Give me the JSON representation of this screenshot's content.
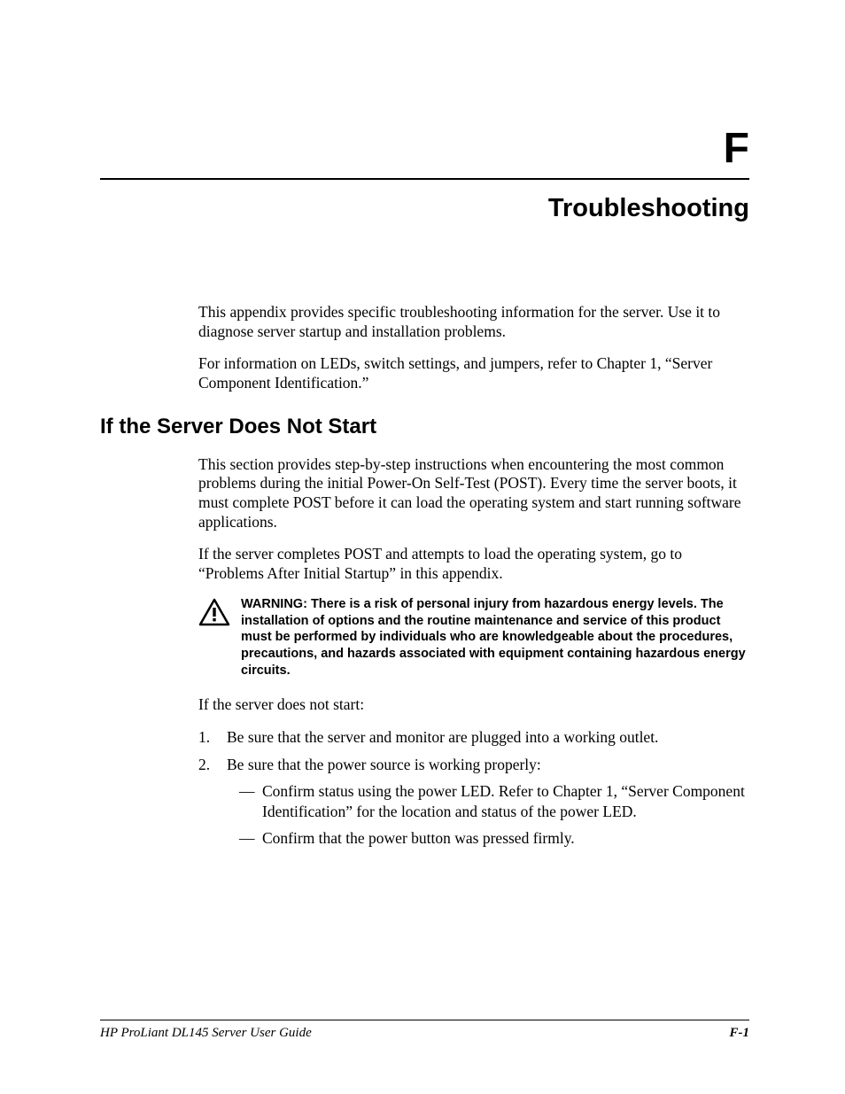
{
  "appendix_letter": "F",
  "chapter_title": "Troubleshooting",
  "intro": {
    "p1": "This appendix provides specific troubleshooting information for the server. Use it to diagnose server startup and installation problems.",
    "p2": "For information on LEDs, switch settings, and jumpers, refer to Chapter 1, “Server Component Identification.”"
  },
  "section1": {
    "heading": "If the Server Does Not Start",
    "p1": "This section provides step-by-step instructions when encountering the most common problems during the initial Power-On Self-Test (POST). Every time the server boots, it must complete POST before it can load the operating system and start running software applications.",
    "p2": "If the server completes POST and attempts to load the operating system, go to “Problems After Initial Startup” in this appendix.",
    "warning_label": "WARNING:  ",
    "warning_text": "There is a risk of personal injury from hazardous energy levels. The installation of options and the routine maintenance and service of this product must be performed by individuals who are knowledgeable about the procedures, precautions, and hazards associated with equipment containing hazardous energy circuits.",
    "p3": "If the server does not start:",
    "list": {
      "item1": "Be sure that the server and monitor are plugged into a working outlet.",
      "item2": "Be sure that the power source is working properly:",
      "item2_sub1": "Confirm status using the power LED. Refer to Chapter 1, “Server Component Identification” for the location and status of the power LED.",
      "item2_sub2": "Confirm that the power button was pressed firmly."
    }
  },
  "footer": {
    "left": "HP ProLiant DL145 Server User Guide",
    "right": "F-1"
  }
}
